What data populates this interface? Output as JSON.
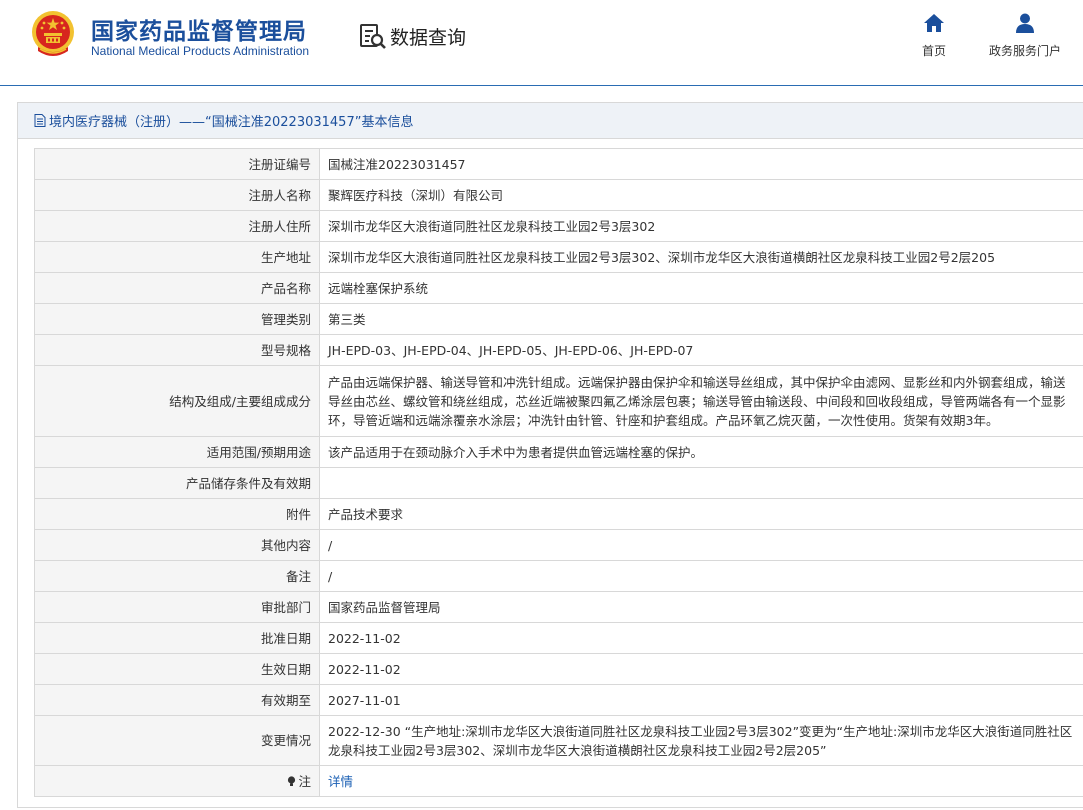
{
  "header": {
    "brand_cn": "国家药品监督管理局",
    "brand_en": "National Medical Products Administration",
    "query_label": "数据查询",
    "nav": {
      "home": "首页",
      "portal": "政务服务门户"
    }
  },
  "panel": {
    "title": "境内医疗器械（注册）——“国械注准20223031457”基本信息"
  },
  "rows": [
    {
      "label": "注册证编号",
      "value": "国械注准20223031457"
    },
    {
      "label": "注册人名称",
      "value": "聚辉医疗科技（深圳）有限公司"
    },
    {
      "label": "注册人住所",
      "value": "深圳市龙华区大浪街道同胜社区龙泉科技工业园2号3层302"
    },
    {
      "label": "生产地址",
      "value": "深圳市龙华区大浪街道同胜社区龙泉科技工业园2号3层302、深圳市龙华区大浪街道横朗社区龙泉科技工业园2号2层205"
    },
    {
      "label": "产品名称",
      "value": "远端栓塞保护系统"
    },
    {
      "label": "管理类别",
      "value": "第三类"
    },
    {
      "label": "型号规格",
      "value": "JH-EPD-03、JH-EPD-04、JH-EPD-05、JH-EPD-06、JH-EPD-07"
    },
    {
      "label": "结构及组成/主要组成成分",
      "value": "产品由远端保护器、输送导管和冲洗针组成。远端保护器由保护伞和输送导丝组成，其中保护伞由滤网、显影丝和内外钢套组成，输送导丝由芯丝、螺纹管和绕丝组成，芯丝近端被聚四氟乙烯涂层包裹；输送导管由输送段、中间段和回收段组成，导管两端各有一个显影环，导管近端和远端涂覆亲水涂层；冲洗针由针管、针座和护套组成。产品环氧乙烷灭菌，一次性使用。货架有效期3年。"
    },
    {
      "label": "适用范围/预期用途",
      "value": "该产品适用于在颈动脉介入手术中为患者提供血管远端栓塞的保护。"
    },
    {
      "label": "产品储存条件及有效期",
      "value": ""
    },
    {
      "label": "附件",
      "value": "产品技术要求"
    },
    {
      "label": "其他内容",
      "value": "/"
    },
    {
      "label": "备注",
      "value": "/"
    },
    {
      "label": "审批部门",
      "value": "国家药品监督管理局"
    },
    {
      "label": "批准日期",
      "value": "2022-11-02"
    },
    {
      "label": "生效日期",
      "value": "2022-11-02"
    },
    {
      "label": "有效期至",
      "value": "2027-11-01"
    },
    {
      "label": "变更情况",
      "value": "2022-12-30 “生产地址:深圳市龙华区大浪街道同胜社区龙泉科技工业园2号3层302”变更为“生产地址:深圳市龙华区大浪街道同胜社区龙泉科技工业园2号3层302、深圳市龙华区大浪街道横朗社区龙泉科技工业园2号2层205”"
    },
    {
      "label": "注",
      "value": "详情"
    }
  ],
  "colors": {
    "brand_blue": "#1b4f9c",
    "link_blue": "#1a5fb4",
    "label_bg": "#f5f5f5",
    "emblem_red": "#d7261e",
    "emblem_gold": "#f2c230"
  },
  "icons": [
    "national-emblem-icon",
    "magnifier-document-icon",
    "home-icon",
    "user-icon",
    "document-icon",
    "lightbulb-icon"
  ]
}
